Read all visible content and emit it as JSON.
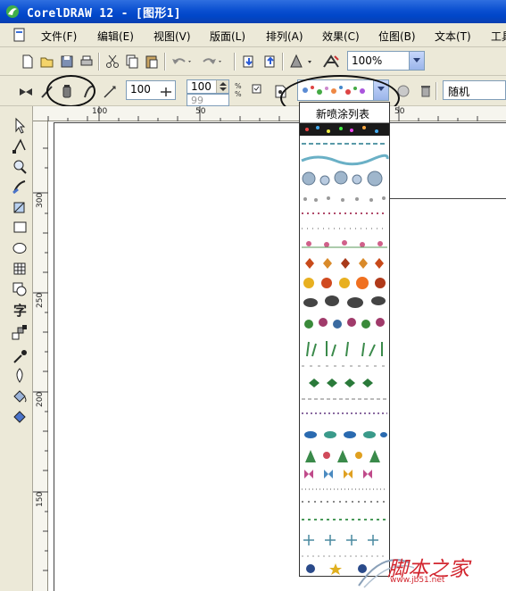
{
  "window": {
    "title": "CorelDRAW 12 - [图形1]"
  },
  "menu": {
    "items": [
      "文件(F)",
      "编辑(E)",
      "视图(V)",
      "版面(L)",
      "排列(A)",
      "效果(C)",
      "位图(B)",
      "文本(T)",
      "工具"
    ]
  },
  "toolbar": {
    "zoom_value": "100%"
  },
  "property_bar": {
    "size_value": "100",
    "dabs_value": "100",
    "spacing_value": "99",
    "order_value": "随机"
  },
  "spray_list": {
    "header": "新喷涂列表"
  },
  "rulers": {
    "top_labels": [
      "100",
      "50",
      "50"
    ],
    "left_labels": [
      "300",
      "250",
      "200",
      "150"
    ]
  },
  "watermark": {
    "text": "脚本之家",
    "url": "www.jb51.net"
  },
  "colors": {
    "titlebar": "#0a4fd0",
    "chrome": "#ece9d8",
    "watermark": "#d2262f"
  }
}
